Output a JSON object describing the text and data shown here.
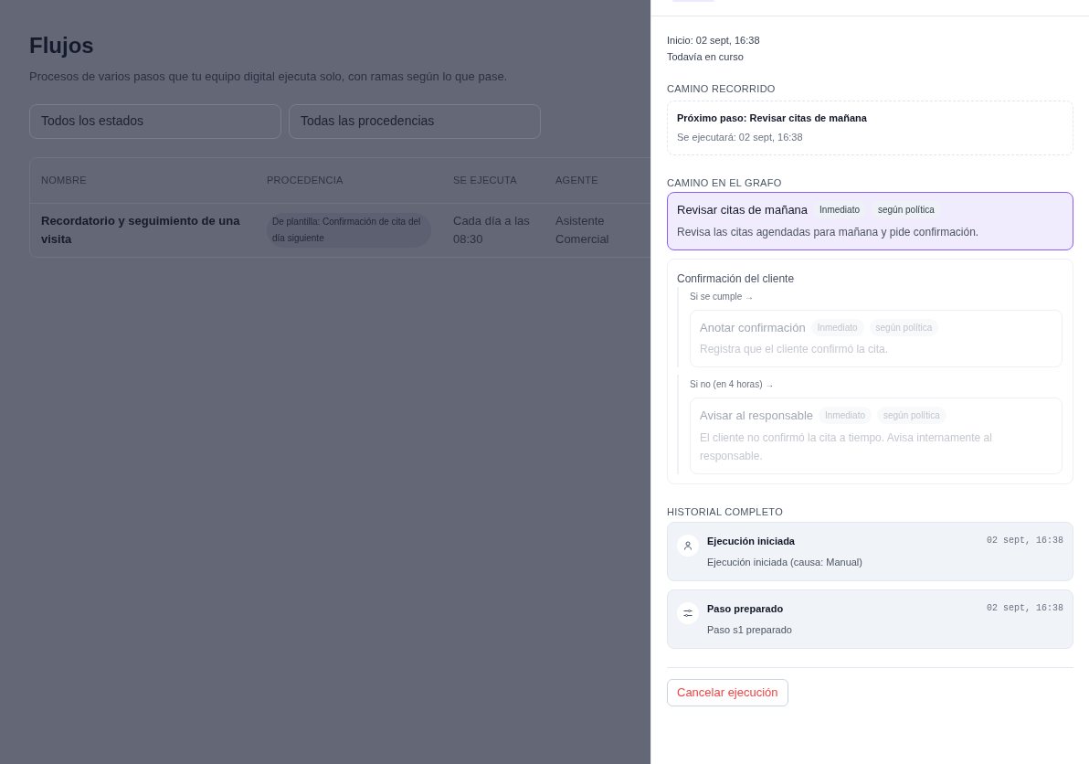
{
  "page": {
    "title": "Flujos",
    "subtitle": "Procesos de varios pasos que tu equipo digital ejecuta solo, con ramas según lo que pase."
  },
  "filters": [
    "Todos los estados",
    "Todas las procedencias"
  ],
  "table": {
    "columns": [
      "NOMBRE",
      "PROCEDENCIA",
      "SE EJECUTA",
      "AGENTE"
    ],
    "rows": [
      {
        "name": "Recordatorio y seguimiento de una visita",
        "origin": "De plantilla: Confirmación de cita del día siguiente",
        "schedule": "Cada día a las 08:30",
        "agent": "Asistente Comercial"
      }
    ]
  },
  "drawer": {
    "start": "Inicio: 02 sept, 16:38",
    "status": "Todavía en curso",
    "path_title": "CAMINO RECORRIDO",
    "next_step": "Próximo paso: Revisar citas de mañana",
    "next_when": "Se ejecutará: 02 sept, 16:38",
    "graph_title": "CAMINO EN EL GRAFO",
    "graph": [
      {
        "kind": "step",
        "active": true,
        "title": "Revisar citas de mañana",
        "tags": [
          "Inmediato",
          "según política"
        ],
        "description": "Revisa las citas agendadas para mañana y pide confirmación."
      },
      {
        "kind": "condition",
        "title": "Confirmación del cliente",
        "branches": [
          {
            "label": "Si se cumple →",
            "step": {
              "active": false,
              "title": "Anotar confirmación",
              "tags": [
                "Inmediato",
                "según política"
              ],
              "description": "Registra que el cliente confirmó la cita."
            }
          },
          {
            "label": "Si no (en 4 horas) →",
            "step": {
              "active": false,
              "title": "Avisar al responsable",
              "tags": [
                "Inmediato",
                "según política"
              ],
              "description": "El cliente no confirmó la cita a tiempo. Avisa internamente al responsable."
            }
          }
        ]
      }
    ],
    "history_title": "HISTORIAL COMPLETO",
    "history": [
      {
        "kind": "person",
        "title": "Ejecución iniciada",
        "time": "02 sept, 16:38",
        "detail": "Ejecución iniciada (causa: Manual)"
      },
      {
        "kind": "step",
        "title": "Paso preparado",
        "time": "02 sept, 16:38",
        "detail": "Paso s1 preparado"
      }
    ],
    "cancel": "Cancelar ejecución"
  }
}
